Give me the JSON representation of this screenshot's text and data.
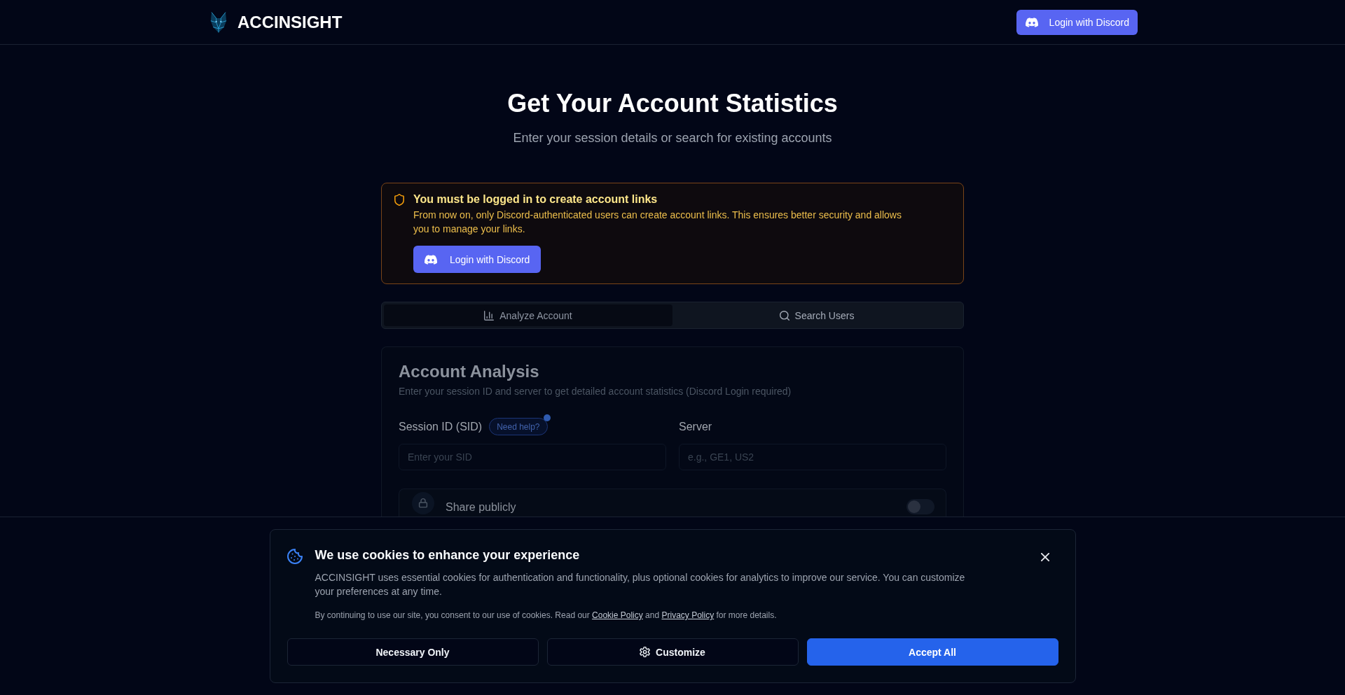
{
  "header": {
    "brand": "ACCINSIGHT",
    "login_button": "Login with Discord"
  },
  "hero": {
    "title": "Get Your Account Statistics",
    "subtitle": "Enter your session details or search for existing accounts"
  },
  "login_notice": {
    "title": "You must be logged in to create account links",
    "message": "From now on, only Discord-authenticated users can create account links. This ensures better security and allows you to manage your links.",
    "button": "Login with Discord"
  },
  "tabs": [
    {
      "label": "Analyze Account",
      "kind": "analyze",
      "selected": true
    },
    {
      "label": "Search Users",
      "kind": "search",
      "selected": false
    }
  ],
  "analysis_card": {
    "title": "Account Analysis",
    "description": "Enter your session ID and server to get detailed account statistics (Discord Login required)",
    "fields": [
      {
        "label": "Session ID (SID)",
        "help_badge": "Need help?",
        "placeholder": "Enter your SID"
      },
      {
        "label": "Server",
        "placeholder": "e.g., GE1, US2"
      }
    ],
    "share_option": {
      "label": "Share publicly",
      "on": false
    }
  },
  "cookie_banner": {
    "title": "We use cookies to enhance your experience",
    "message": "ACCINSIGHT uses essential cookies for authentication and functionality, plus optional cookies for analytics to improve our service. You can customize your preferences at any time.",
    "consent": [
      {
        "kind": "text",
        "text": "By continuing to use our site, you consent to our use of cookies. Read our "
      },
      {
        "kind": "link",
        "text": "Cookie Policy"
      },
      {
        "kind": "text",
        "text": " and "
      },
      {
        "kind": "link",
        "text": "Privacy Policy"
      },
      {
        "kind": "text",
        "text": " for more details."
      }
    ],
    "buttons": [
      {
        "label": "Necessary Only",
        "kind": "outline"
      },
      {
        "label": "Customize",
        "kind": "settings"
      },
      {
        "label": "Accept All",
        "kind": "primary"
      }
    ]
  }
}
